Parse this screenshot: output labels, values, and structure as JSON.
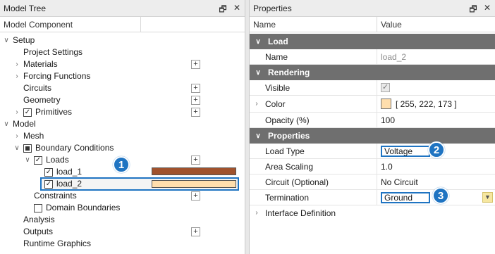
{
  "tree_panel": {
    "title": "Model Tree",
    "pin_icon": "pin-icon",
    "close_glyph": "✕",
    "column_header": "Model Component",
    "items": [
      {
        "label": "Setup",
        "expanded": true
      },
      {
        "label": "Project Settings"
      },
      {
        "label": "Materials"
      },
      {
        "label": "Forcing Functions"
      },
      {
        "label": "Circuits"
      },
      {
        "label": "Geometry"
      },
      {
        "label": "Primitives",
        "checked": true
      },
      {
        "label": "Model",
        "expanded": true
      },
      {
        "label": "Mesh"
      },
      {
        "label": "Boundary Conditions"
      },
      {
        "label": "Loads",
        "checked": true
      },
      {
        "label": "load_1",
        "checked": true,
        "color": "#A0522D"
      },
      {
        "label": "load_2",
        "checked": true,
        "color": "#FFDEAD",
        "selected": true
      },
      {
        "label": "Constraints"
      },
      {
        "label": "Domain Boundaries",
        "checked": false
      },
      {
        "label": "Analysis"
      },
      {
        "label": "Outputs"
      },
      {
        "label": "Runtime Graphics"
      }
    ]
  },
  "props_panel": {
    "title": "Properties",
    "col_name": "Name",
    "col_value": "Value",
    "sections": {
      "load": "Load",
      "rendering": "Rendering",
      "properties": "Properties"
    },
    "rows": {
      "name": {
        "label": "Name",
        "value": "load_2"
      },
      "visible": {
        "label": "Visible",
        "value": "✓"
      },
      "color": {
        "label": "Color",
        "value": "[ 255, 222, 173 ]",
        "swatch": "#FFDEAD"
      },
      "opacity": {
        "label": "Opacity (%)",
        "value": "100"
      },
      "load_type": {
        "label": "Load Type",
        "value": "Voltage"
      },
      "area_scaling": {
        "label": "Area Scaling",
        "value": "1.0"
      },
      "circuit": {
        "label": "Circuit (Optional)",
        "value": "No Circuit"
      },
      "termination": {
        "label": "Termination",
        "value": "Ground"
      },
      "interface": {
        "label": "Interface Definition"
      }
    }
  },
  "callouts": [
    "1",
    "2",
    "3"
  ],
  "colors": {
    "accent": "#1F74C2",
    "section_bg": "#6F6F6F"
  }
}
